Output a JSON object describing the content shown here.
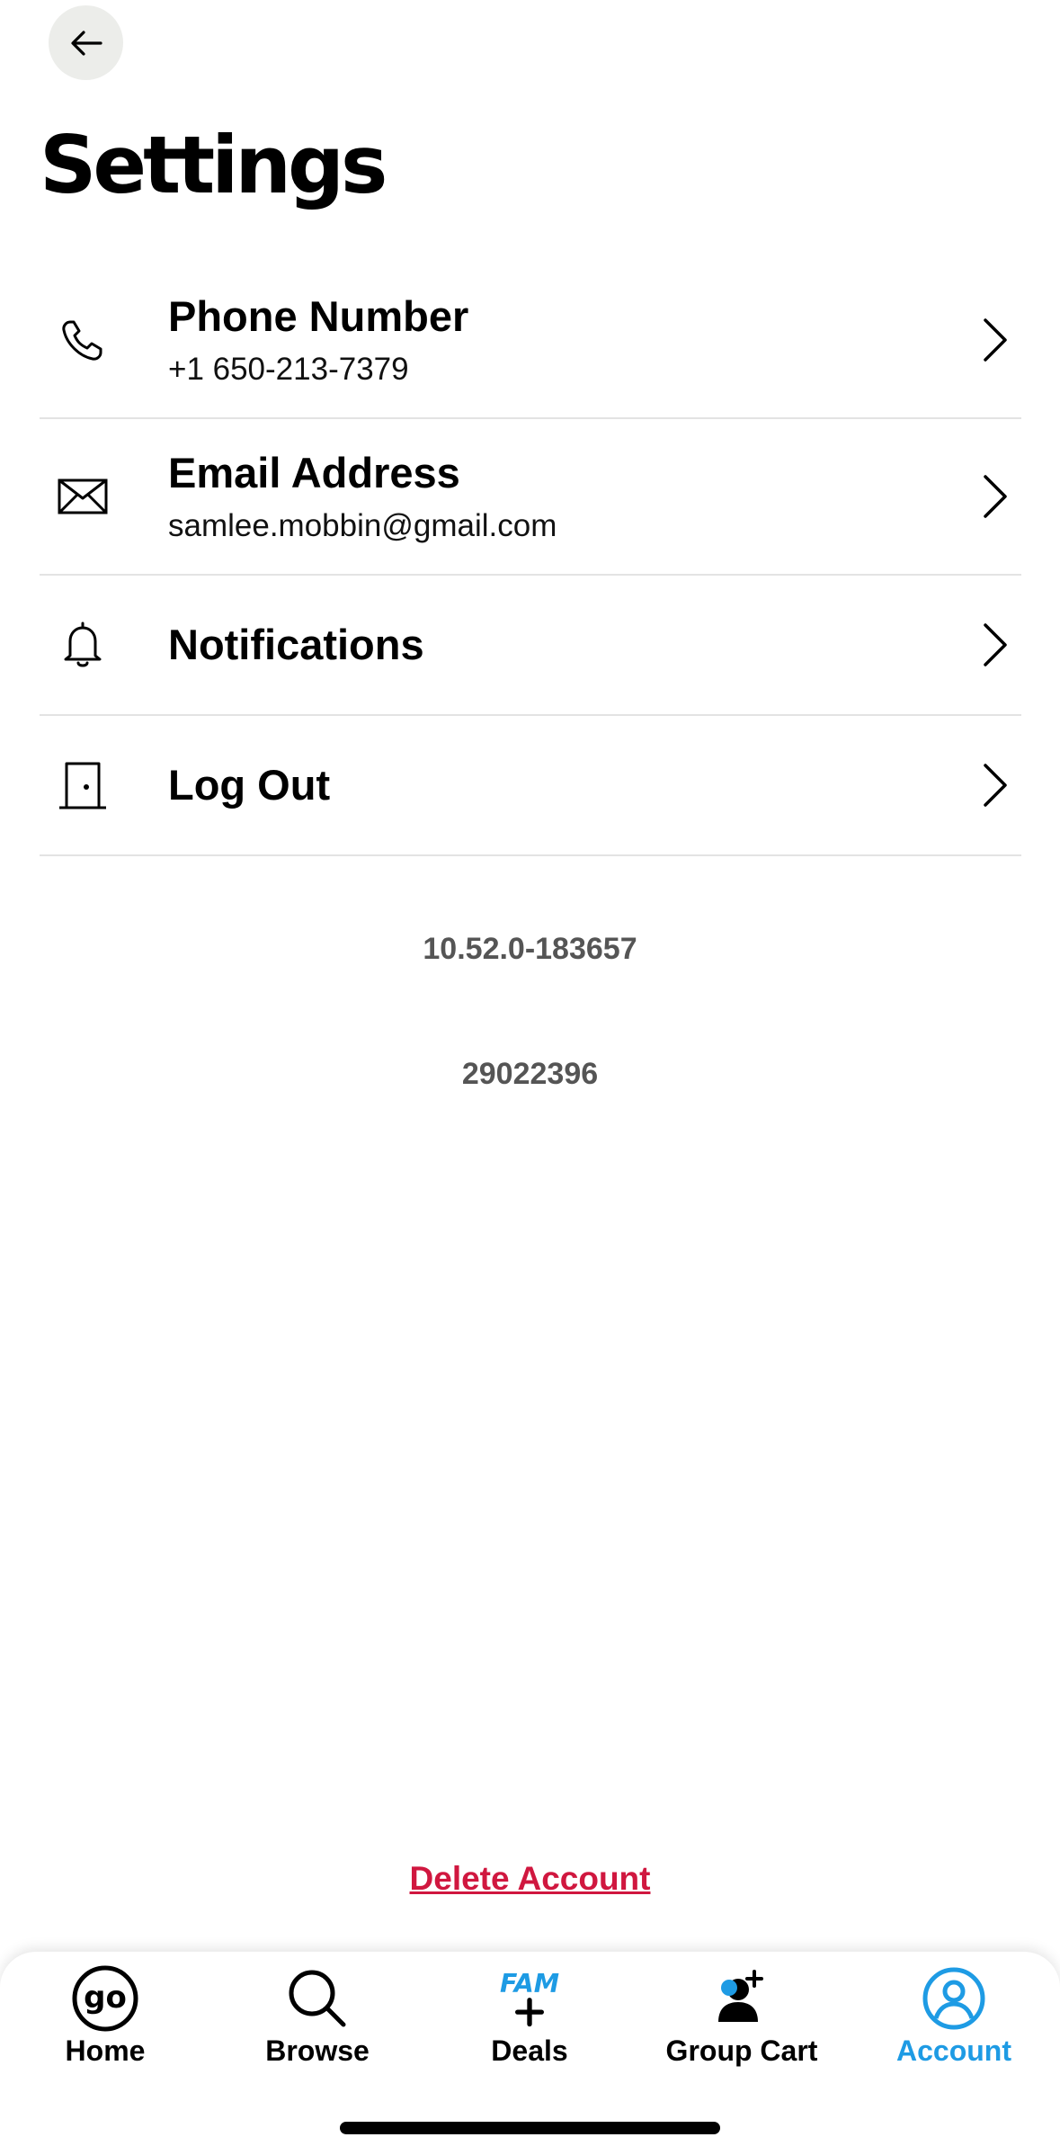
{
  "header": {
    "title": "Settings",
    "back_icon": "arrow-left-icon"
  },
  "settings": [
    {
      "title": "Phone Number",
      "value": "+1 650-213-7379",
      "icon": "phone-icon"
    },
    {
      "title": "Email Address",
      "value": "samlee.mobbin@gmail.com",
      "icon": "envelope-icon"
    },
    {
      "title": "Notifications",
      "icon": "bell-icon"
    },
    {
      "title": "Log Out",
      "icon": "door-icon"
    }
  ],
  "version": {
    "app_version": "10.52.0-183657",
    "build_number": "29022396"
  },
  "delete_account": "Delete Account",
  "tabs": [
    {
      "label": "Home",
      "icon": "go-logo-icon"
    },
    {
      "label": "Browse",
      "icon": "search-icon"
    },
    {
      "label": "Deals",
      "icon": "fam-plus-icon",
      "badge": "FAM"
    },
    {
      "label": "Group Cart",
      "icon": "add-person-icon"
    },
    {
      "label": "Account",
      "icon": "user-circle-icon",
      "active": true
    }
  ],
  "colors": {
    "accent": "#1e9be4",
    "danger": "#d0173f",
    "muted": "#555555",
    "back_button_bg": "#ecedea"
  }
}
